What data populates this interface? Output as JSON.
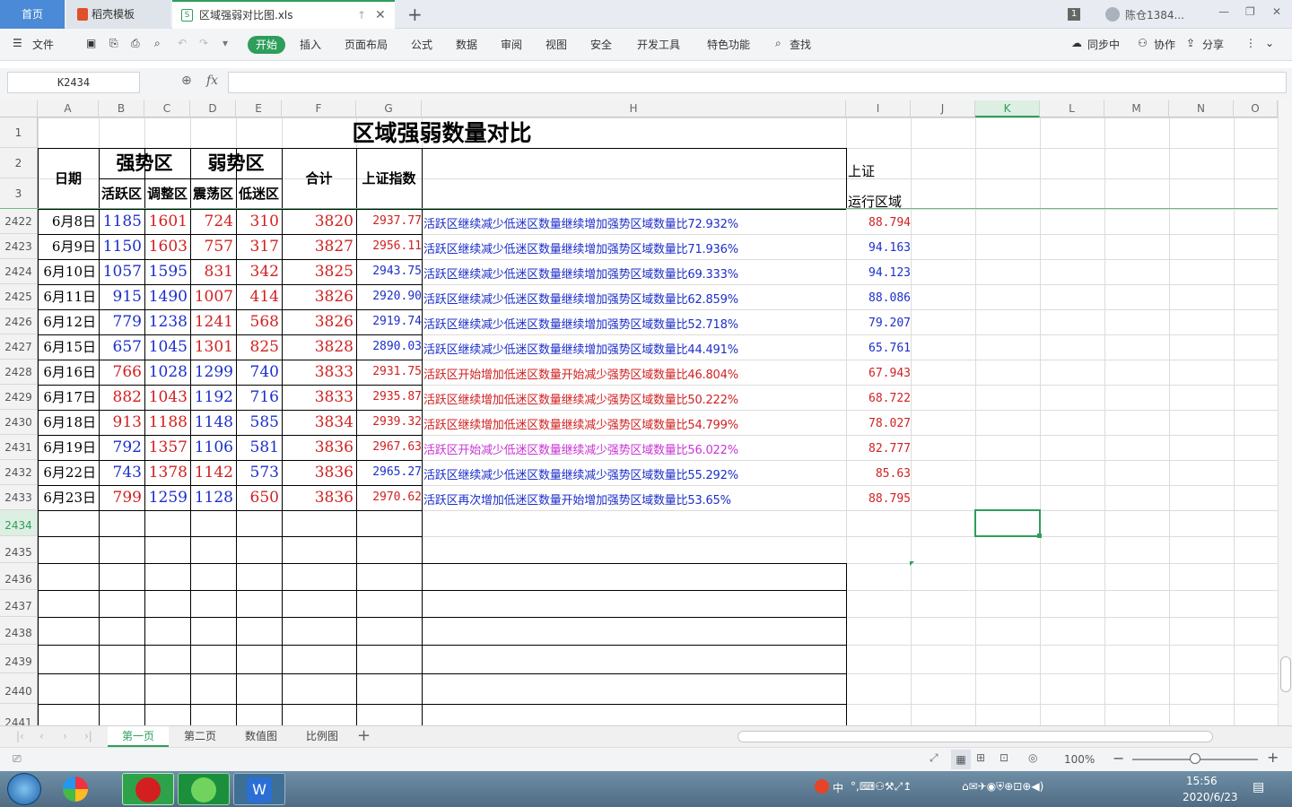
{
  "tabs": {
    "home": "首页",
    "template": "稻壳模板",
    "file": "区域强弱对比图.xls"
  },
  "window": {
    "badge": "1",
    "user": "陈仓1384..."
  },
  "menu": {
    "file": "文件",
    "start": "开始",
    "insert": "插入",
    "layout": "页面布局",
    "formula": "公式",
    "data": "数据",
    "review": "审阅",
    "view": "视图",
    "security": "安全",
    "devtools": "开发工具",
    "special": "特色功能",
    "find": "查找",
    "sync": "同步中",
    "collab": "协作",
    "share": "分享"
  },
  "formula": {
    "namebox": "K2434",
    "fx": "fx",
    "value": ""
  },
  "columns": [
    "A",
    "B",
    "C",
    "D",
    "E",
    "F",
    "G",
    "H",
    "I",
    "J",
    "K",
    "L",
    "M",
    "N",
    "O"
  ],
  "header": {
    "title": "区域强弱数量对比",
    "date": "日期",
    "strong": "强势区",
    "weak": "弱势区",
    "active": "活跃区",
    "adjust": "调整区",
    "shock": "震荡区",
    "low": "低迷区",
    "total": "合计",
    "index": "上证指数",
    "i2": "上证",
    "i3": "运行区域"
  },
  "header_rows": [
    "1",
    "2",
    "3"
  ],
  "rows": [
    {
      "r": "2422",
      "date": "6月8日",
      "b": "1185",
      "c": "1601",
      "d": "724",
      "e": "310",
      "f": "3820",
      "g": "2937.77",
      "h": "活跃区继续减少低迷区数量继续增加强势区域数量比72.932%",
      "i": "88.794",
      "hc": "blue",
      "bc": "blue",
      "cc": "red",
      "dc": "red",
      "ec": "red",
      "gc": "red",
      "ic": "red"
    },
    {
      "r": "2423",
      "date": "6月9日",
      "b": "1150",
      "c": "1603",
      "d": "757",
      "e": "317",
      "f": "3827",
      "g": "2956.11",
      "h": "活跃区继续减少低迷区数量继续增加强势区域数量比71.936%",
      "i": "94.163",
      "hc": "blue",
      "bc": "blue",
      "cc": "red",
      "dc": "red",
      "ec": "red",
      "gc": "red",
      "ic": "blue"
    },
    {
      "r": "2424",
      "date": "6月10日",
      "b": "1057",
      "c": "1595",
      "d": "831",
      "e": "342",
      "f": "3825",
      "g": "2943.75",
      "h": "活跃区继续减少低迷区数量继续增加强势区域数量比69.333%",
      "i": "94.123",
      "hc": "blue",
      "bc": "blue",
      "cc": "blue",
      "dc": "red",
      "ec": "red",
      "gc": "blue",
      "ic": "blue"
    },
    {
      "r": "2425",
      "date": "6月11日",
      "b": "915",
      "c": "1490",
      "d": "1007",
      "e": "414",
      "f": "3826",
      "g": "2920.90",
      "h": "活跃区继续减少低迷区数量继续增加强势区域数量比62.859%",
      "i": "88.086",
      "hc": "blue",
      "bc": "blue",
      "cc": "blue",
      "dc": "red",
      "ec": "red",
      "gc": "blue",
      "ic": "blue"
    },
    {
      "r": "2426",
      "date": "6月12日",
      "b": "779",
      "c": "1238",
      "d": "1241",
      "e": "568",
      "f": "3826",
      "g": "2919.74",
      "h": "活跃区继续减少低迷区数量继续增加强势区域数量比52.718%",
      "i": "79.207",
      "hc": "blue",
      "bc": "blue",
      "cc": "blue",
      "dc": "red",
      "ec": "red",
      "gc": "blue",
      "ic": "blue"
    },
    {
      "r": "2427",
      "date": "6月15日",
      "b": "657",
      "c": "1045",
      "d": "1301",
      "e": "825",
      "f": "3828",
      "g": "2890.03",
      "h": "活跃区继续减少低迷区数量继续增加强势区域数量比44.491%",
      "i": "65.761",
      "hc": "blue",
      "bc": "blue",
      "cc": "blue",
      "dc": "red",
      "ec": "red",
      "gc": "blue",
      "ic": "blue"
    },
    {
      "r": "2428",
      "date": "6月16日",
      "b": "766",
      "c": "1028",
      "d": "1299",
      "e": "740",
      "f": "3833",
      "g": "2931.75",
      "h": "活跃区开始增加低迷区数量开始减少强势区域数量比46.804%",
      "i": "67.943",
      "hc": "red",
      "bc": "red",
      "cc": "blue",
      "dc": "blue",
      "ec": "blue",
      "gc": "red",
      "ic": "red"
    },
    {
      "r": "2429",
      "date": "6月17日",
      "b": "882",
      "c": "1043",
      "d": "1192",
      "e": "716",
      "f": "3833",
      "g": "2935.87",
      "h": "活跃区继续增加低迷区数量继续减少强势区域数量比50.222%",
      "i": "68.722",
      "hc": "red",
      "bc": "red",
      "cc": "red",
      "dc": "blue",
      "ec": "blue",
      "gc": "red",
      "ic": "red"
    },
    {
      "r": "2430",
      "date": "6月18日",
      "b": "913",
      "c": "1188",
      "d": "1148",
      "e": "585",
      "f": "3834",
      "g": "2939.32",
      "h": "活跃区继续增加低迷区数量继续减少强势区域数量比54.799%",
      "i": "78.027",
      "hc": "red",
      "bc": "red",
      "cc": "red",
      "dc": "blue",
      "ec": "blue",
      "gc": "red",
      "ic": "red"
    },
    {
      "r": "2431",
      "date": "6月19日",
      "b": "792",
      "c": "1357",
      "d": "1106",
      "e": "581",
      "f": "3836",
      "g": "2967.63",
      "h": "活跃区开始减少低迷区数量继续减少强势区域数量比56.022%",
      "i": "82.777",
      "hc": "magenta",
      "bc": "blue",
      "cc": "red",
      "dc": "blue",
      "ec": "blue",
      "gc": "red",
      "ic": "red"
    },
    {
      "r": "2432",
      "date": "6月22日",
      "b": "743",
      "c": "1378",
      "d": "1142",
      "e": "573",
      "f": "3836",
      "g": "2965.27",
      "h": "活跃区继续减少低迷区数量继续减少强势区域数量比55.292%",
      "i": "85.63",
      "hc": "blue",
      "bc": "blue",
      "cc": "red",
      "dc": "red",
      "ec": "blue",
      "gc": "blue",
      "ic": "red"
    },
    {
      "r": "2433",
      "date": "6月23日",
      "b": "799",
      "c": "1259",
      "d": "1128",
      "e": "650",
      "f": "3836",
      "g": "2970.62",
      "h": "活跃区再次增加低迷区数量开始增加强势区域数量比53.65%",
      "i": "88.795",
      "hc": "blue",
      "bc": "red",
      "cc": "blue",
      "dc": "blue",
      "ec": "red",
      "gc": "red",
      "ic": "red"
    }
  ],
  "empty_rows": [
    "2434",
    "2435",
    "2436",
    "2437",
    "2438",
    "2439",
    "2440",
    "2441"
  ],
  "sheets": [
    "第一页",
    "第二页",
    "数值图",
    "比例图"
  ],
  "status": {
    "zoom": "100%"
  },
  "taskbar": {
    "time": "15:56",
    "date": "2020/6/23",
    "ime": "中"
  },
  "colors": {
    "blue": "#1c2fc9",
    "red": "#d12121",
    "magenta": "#c934d6",
    "accent": "#2f9e5b"
  }
}
